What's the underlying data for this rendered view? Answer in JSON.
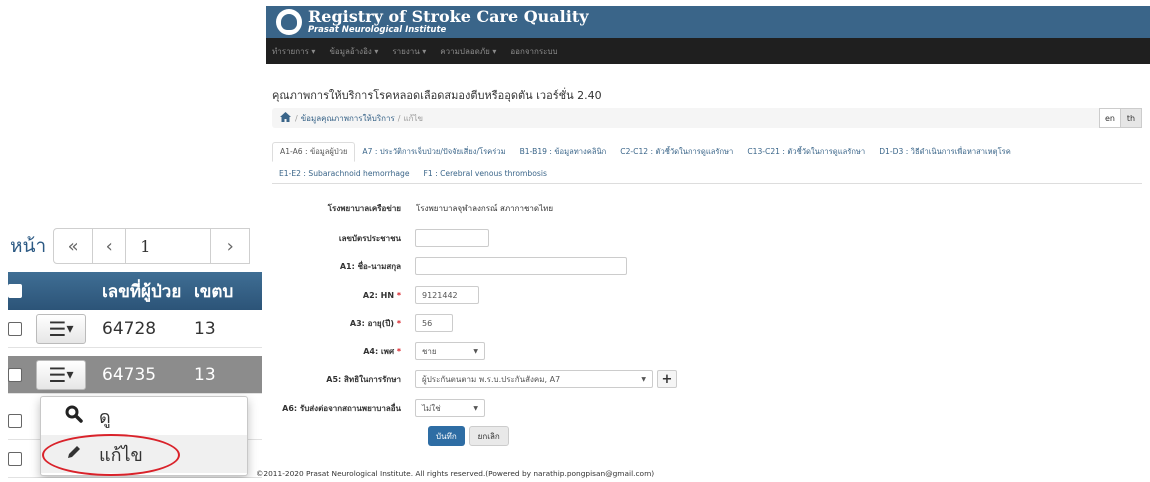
{
  "inset": {
    "pager": {
      "label": "หน้า",
      "first": "«",
      "prev": "‹",
      "page": "1",
      "next": "›"
    },
    "columns": [
      "เลขที่ผู้ป่วย",
      "เขตบ"
    ],
    "rows": [
      {
        "id": "64728",
        "zone": "13",
        "selected": false
      },
      {
        "id": "64735",
        "zone": "13",
        "selected": true
      }
    ],
    "menu_button_caret": "▾",
    "dropdown": {
      "view_label": "ดู",
      "edit_label": "แก้ไข"
    }
  },
  "header": {
    "title": "Registry of Stroke Care Quality",
    "subtitle": "Prasat Neurological Institute",
    "nav": [
      "ทำรายการ ▾",
      "ข้อมูลอ้างอิง ▾",
      "รายงาน ▾",
      "ความปลอดภัย ▾",
      "ออกจากระบบ"
    ]
  },
  "page_title": "คุณภาพการให้บริการโรคหลอดเลือดสมองตีบหรืออุดตัน เวอร์ชั่น 2.40",
  "breadcrumb": {
    "section": "ข้อมูลคุณภาพการให้บริการ",
    "current": "แก้ไข"
  },
  "language": {
    "en": "en",
    "th": "th"
  },
  "tabs_row1": [
    "A1-A6 : ข้อมูลผู้ป่วย",
    "A7 : ประวัติการเจ็บป่วย/ปัจจัยเสี่ยง/โรคร่วม",
    "B1-B19 : ข้อมูลทางคลินิก",
    "C2-C12 : ตัวชี้วัดในการดูแลรักษา",
    "C13-C21 : ตัวชี้วัดในการดูแลรักษา",
    "D1-D3 : วิธีดำเนินการเพื่อหาสาเหตุโรค"
  ],
  "tabs_row2": [
    "E1-E2 : Subarachnoid hemorrhage",
    "F1 : Cerebral venous thrombosis"
  ],
  "form": {
    "hospital": {
      "label": "โรงพยาบาลเครือข่าย",
      "value": "โรงพยาบาลจุฬาลงกรณ์ สภากาชาดไทย"
    },
    "citizen_id": {
      "label": "เลขบัตรประชาชน",
      "value": ""
    },
    "name": {
      "label": "A1: ชื่อ-นามสกุล",
      "value": ""
    },
    "hn": {
      "label": "A2: HN",
      "value": "9121442",
      "required": "*"
    },
    "age": {
      "label": "A3: อายุ(ปี)",
      "value": "56",
      "required": "*"
    },
    "sex": {
      "label": "A4: เพศ",
      "value": "ชาย",
      "required": "*"
    },
    "rights": {
      "label": "A5: สิทธิในการรักษา",
      "value": "ผู้ประกันตนตาม พ.ร.บ.ประกันสังคม, A7",
      "add": "+"
    },
    "referral": {
      "label": "A6: รับส่งต่อจากสถานพยาบาลอื่น",
      "value": "ไม่ใช่"
    },
    "save": "บันทึก",
    "cancel": "ยกเลิก"
  },
  "footer": "©2011-2020 Prasat Neurological Institute. All rights reserved.(Powered by narathip.pongpisan@gmail.com)",
  "colors": {
    "brand": "#3a6589",
    "navbar": "#1f1f1f",
    "primary_button": "#2e6da4",
    "highlight_ellipse": "#d9222a"
  }
}
